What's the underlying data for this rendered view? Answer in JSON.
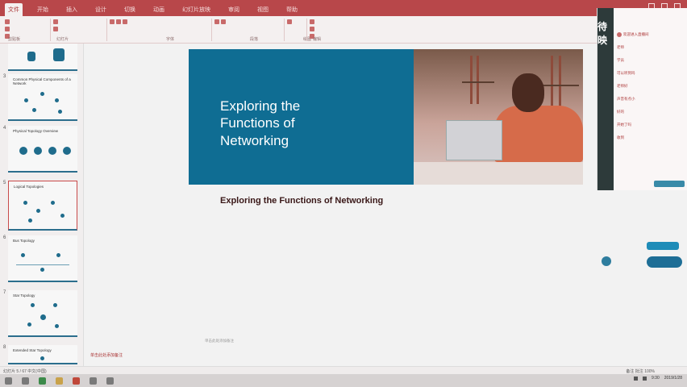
{
  "ribbon": {
    "tabs": [
      "文件",
      "开始",
      "插入",
      "设计",
      "切换",
      "动画",
      "幻灯片放映",
      "审阅",
      "视图",
      "帮助"
    ],
    "groups": [
      "剪贴板",
      "幻灯片",
      "字体",
      "段落",
      "绘图",
      "编辑"
    ]
  },
  "thumbnails": [
    {
      "number": "",
      "title": ""
    },
    {
      "number": "3",
      "title": "Common Physical Components of a Network"
    },
    {
      "number": "4",
      "title": "Physical Topology Overview"
    },
    {
      "number": "5",
      "title": "Logical Topologies"
    },
    {
      "number": "6",
      "title": "Bus Topology"
    },
    {
      "number": "7",
      "title": "Star Topology"
    },
    {
      "number": "8",
      "title": "Extended Star Topology"
    }
  ],
  "slide": {
    "title_lines": [
      "Exploring the",
      "Functions of",
      "Networking"
    ]
  },
  "notes": "Exploring the Functions of Networking",
  "canvas_footer": "单击此处添加备注",
  "status_note": "单击此处添加备注",
  "chat": {
    "video_label": "待映",
    "lines": [
      "欢迎进入直播间",
      "老师",
      "学员",
      "可以听到吗",
      "老师好",
      "声音有点小",
      "好的",
      "开始了吗",
      "收到"
    ]
  },
  "statusbar": {
    "left": "幻灯片 5 / 67  中文(中国)",
    "right": "备注  批注  100%"
  },
  "taskbar": {
    "time": "9:30",
    "date": "2019/1/28"
  },
  "colors": {
    "accent": "#b8474a",
    "slide_blue": "#0f6d93"
  }
}
